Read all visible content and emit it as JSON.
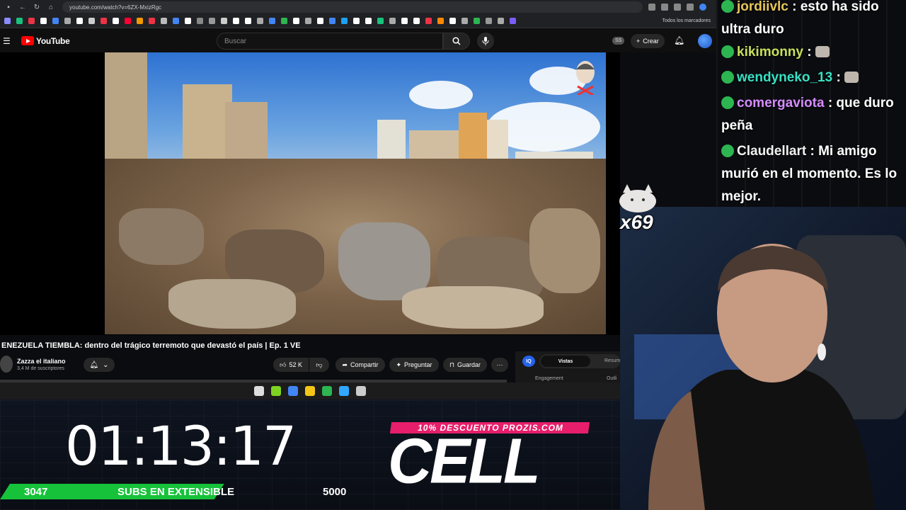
{
  "browser": {
    "url": "youtube.com/watch?v=6ZX-MxizRgc",
    "all_bookmarks_label": "Todos los marcadores",
    "bookmark_colors": [
      "#8a8cff",
      "#19c37d",
      "#e34",
      "#fff",
      "#4285f4",
      "#aaa",
      "#fff",
      "#ccc",
      "#e34",
      "#fff",
      "#ff0033",
      "#f29900",
      "#e34",
      "#bbb",
      "#4285f4",
      "#fff",
      "#888",
      "#999",
      "#ccc",
      "#fff",
      "#fff",
      "#aaa",
      "#4285f4",
      "#2db552",
      "#fff",
      "#aaa",
      "#fff",
      "#4285f4",
      "#1da1f2",
      "#fff",
      "#fff",
      "#19c37d",
      "#aaa",
      "#fff",
      "#fff",
      "#e34",
      "#f80",
      "#fff",
      "#aaa",
      "#2db552",
      "#999",
      "#aaa",
      "#7c5cff"
    ]
  },
  "youtube": {
    "logo_text": "YouTube",
    "search_placeholder": "Buscar",
    "ss_badge": "SS",
    "create_label": "Crear",
    "video_title": "ENEZUELA TIEMBLA: dentro del trágico terremoto que devastó el país | Ep. 1 VE",
    "channel_name": "Zazza el italiano",
    "channel_subs": "3,4 M de suscriptores",
    "likes": "52 K",
    "share_label": "Compartir",
    "ask_label": "Preguntar",
    "save_label": "Guardar",
    "more_label": "···",
    "panel": {
      "iq_badge": "IQ",
      "tab_active": "Vistas",
      "tab_other": "Resum",
      "engagement": "Engagement",
      "outline": "Outli"
    }
  },
  "taskbar": {
    "icon_colors": [
      "#ddd",
      "#7ed321",
      "#4285f4",
      "#f5c518",
      "#2db552",
      "#31a8ff",
      "#ccc"
    ]
  },
  "stream": {
    "timer": "01:13:17",
    "subs_current": "3047",
    "subs_label": "SUBS EN EXTENSIBLE",
    "subs_goal": "5000",
    "subs_progress": 0.609,
    "promo_text": "10% DESCUENTO PROZIS.COM",
    "brand_text": "CELL",
    "emote_count": "x69"
  },
  "chat": [
    {
      "user": "jordiivlc",
      "color": "#e6c55a",
      "text": " : esto ha sido ultra duro",
      "emote": false
    },
    {
      "user": "kikimonny",
      "color": "#c8e05a",
      "text": " : ",
      "emote": true
    },
    {
      "user": "wendyneko_13",
      "color": "#39e0c3",
      "text": " : ",
      "emote": true
    },
    {
      "user": "comergaviota",
      "color": "#d58bff",
      "text": " : que duro peña",
      "emote": false
    },
    {
      "user": "Claudellart",
      "color": "#f1f1f1",
      "text": " : Mi amigo murió en el momento. Es lo mejor.",
      "emote": false
    }
  ]
}
